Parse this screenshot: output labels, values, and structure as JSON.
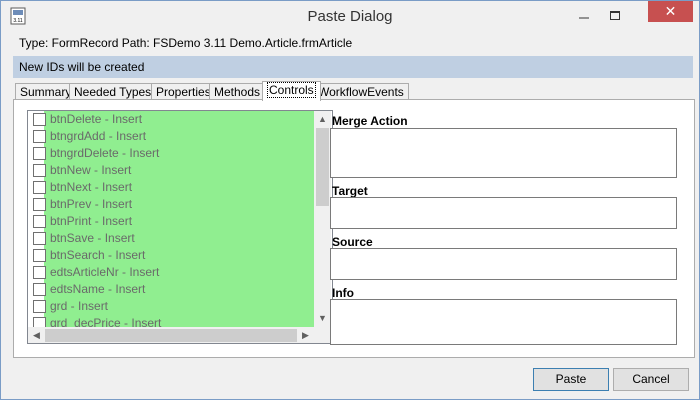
{
  "window": {
    "title": "Paste Dialog",
    "icon_name": "app-icon",
    "icon_text": "3.11",
    "minimize_icon": "minimize-icon",
    "maximize_icon": "maximize-icon",
    "close_glyph": "✕",
    "close_color": "#c75050"
  },
  "header": {
    "type_path_text": "Type: FormRecord Path: FSDemo 3.11 Demo.Article.frmArticle",
    "status_text": "New IDs will be created",
    "status_bg": "#bfcfe2"
  },
  "tabs": [
    {
      "label": "Summary",
      "active": false
    },
    {
      "label": "Needed Types",
      "active": false
    },
    {
      "label": "Properties",
      "active": false
    },
    {
      "label": "Methods",
      "active": false
    },
    {
      "label": "Controls",
      "active": true
    },
    {
      "label": "WorkflowEvents",
      "active": false
    }
  ],
  "controls_list": {
    "highlight_color": "#90ee90",
    "items": [
      {
        "label": "btnDelete - Insert",
        "checked": false
      },
      {
        "label": "btngrdAdd - Insert",
        "checked": false
      },
      {
        "label": "btngrdDelete - Insert",
        "checked": false
      },
      {
        "label": "btnNew - Insert",
        "checked": false
      },
      {
        "label": "btnNext - Insert",
        "checked": false
      },
      {
        "label": "btnPrev - Insert",
        "checked": false
      },
      {
        "label": "btnPrint - Insert",
        "checked": false
      },
      {
        "label": "btnSave - Insert",
        "checked": false
      },
      {
        "label": "btnSearch - Insert",
        "checked": false
      },
      {
        "label": "edtsArticleNr - Insert",
        "checked": false
      },
      {
        "label": "edtsName - Insert",
        "checked": false
      },
      {
        "label": "grd - Insert",
        "checked": false
      },
      {
        "label": "grd_decPrice - Insert",
        "checked": false
      }
    ]
  },
  "fields": {
    "merge_action_label": "Merge Action",
    "target_label": "Target",
    "source_label": "Source",
    "info_label": "Info"
  },
  "buttons": {
    "paste_label": "Paste",
    "cancel_label": "Cancel"
  }
}
